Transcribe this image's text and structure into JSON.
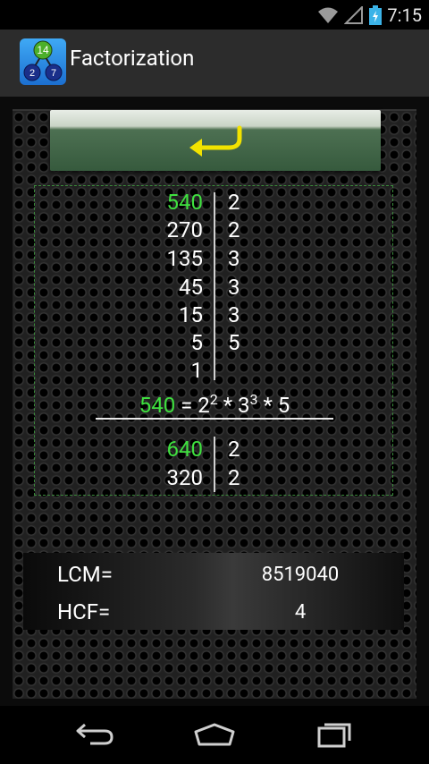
{
  "status": {
    "time": "7:15"
  },
  "app": {
    "title": "Factorization",
    "icon_numbers": {
      "top": "14",
      "left": "2",
      "right": "7"
    }
  },
  "factorization1": {
    "rows": [
      {
        "num": "540",
        "factor": "2"
      },
      {
        "num": "270",
        "factor": "2"
      },
      {
        "num": "135",
        "factor": "3"
      },
      {
        "num": "45",
        "factor": "3"
      },
      {
        "num": "15",
        "factor": "3"
      },
      {
        "num": "5",
        "factor": "5"
      },
      {
        "num": "1",
        "factor": ""
      }
    ],
    "equation": {
      "number": "540",
      "equals": " = ",
      "base1": "2",
      "exp1": "2",
      "times1": " * ",
      "base2": "3",
      "exp2": "3",
      "times2": " * ",
      "base3": "5"
    }
  },
  "factorization2": {
    "rows": [
      {
        "num": "640",
        "factor": "2"
      },
      {
        "num": "320",
        "factor": "2"
      }
    ]
  },
  "results": {
    "lcm_label": "LCM=",
    "lcm_value": "8519040",
    "hcf_label": "HCF=",
    "hcf_value": "4"
  },
  "colors": {
    "highlight": "#3fe03f",
    "undo_arrow": "#f2e200"
  },
  "icons": {
    "undo": "undo-arrow-icon",
    "nav_back": "back-icon",
    "nav_home": "home-icon",
    "nav_recents": "recents-icon"
  }
}
